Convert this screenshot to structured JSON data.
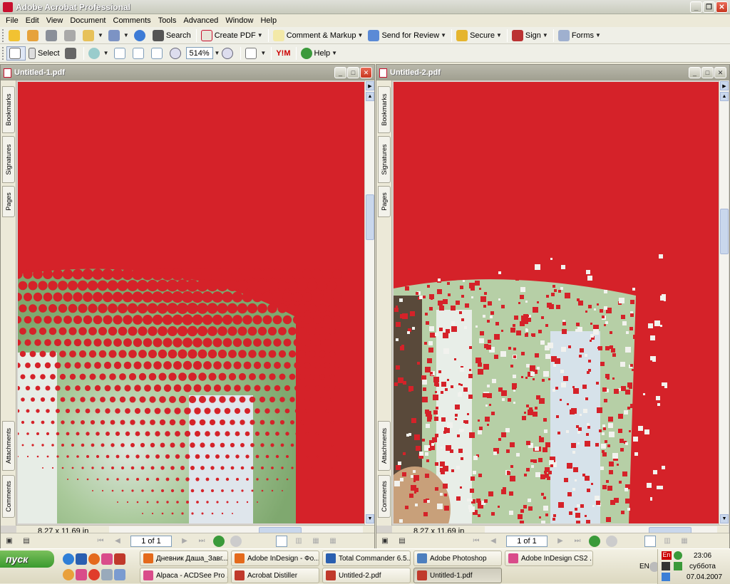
{
  "app": {
    "title": "Adobe Acrobat Professional"
  },
  "menu": [
    "File",
    "Edit",
    "View",
    "Document",
    "Comments",
    "Tools",
    "Advanced",
    "Window",
    "Help"
  ],
  "toolbar1": {
    "search": "Search",
    "create_pdf": "Create PDF",
    "comment_markup": "Comment & Markup",
    "send_review": "Send for Review",
    "secure": "Secure",
    "sign": "Sign",
    "forms": "Forms"
  },
  "toolbar2": {
    "select": "Select",
    "zoom": "514%",
    "help": "Help",
    "yim": "Y!M"
  },
  "doc1": {
    "title": "Untitled-1.pdf",
    "page_size": "8,27 x 11,69 in",
    "page_label": "1 of 1"
  },
  "doc2": {
    "title": "Untitled-2.pdf",
    "page_size": "8,27 x 11,69 in",
    "page_label": "1 of 1"
  },
  "navtabs": {
    "bookmarks": "Bookmarks",
    "signatures": "Signatures",
    "pages": "Pages",
    "attachments": "Attachments",
    "comments": "Comments"
  },
  "taskbar": {
    "start": "пуск",
    "tasks_top": [
      "Дневник Даша_Завг...",
      "Adobe InDesign - Фо...",
      "Total Commander 6.5...",
      "Adobe Photoshop",
      "Adobe InDesign CS2 ..."
    ],
    "tasks_bottom": [
      "Alpaca - ACDSee Pro ...",
      "Acrobat Distiller",
      "Untitled-2.pdf",
      "Untitled-1.pdf"
    ]
  },
  "tray": {
    "lang": "EN",
    "lang2": "En",
    "time": "23:06",
    "day": "суббота",
    "date": "07.04.2007"
  },
  "colors": {
    "page_red": "#d52229",
    "accent": "#c8102e"
  }
}
